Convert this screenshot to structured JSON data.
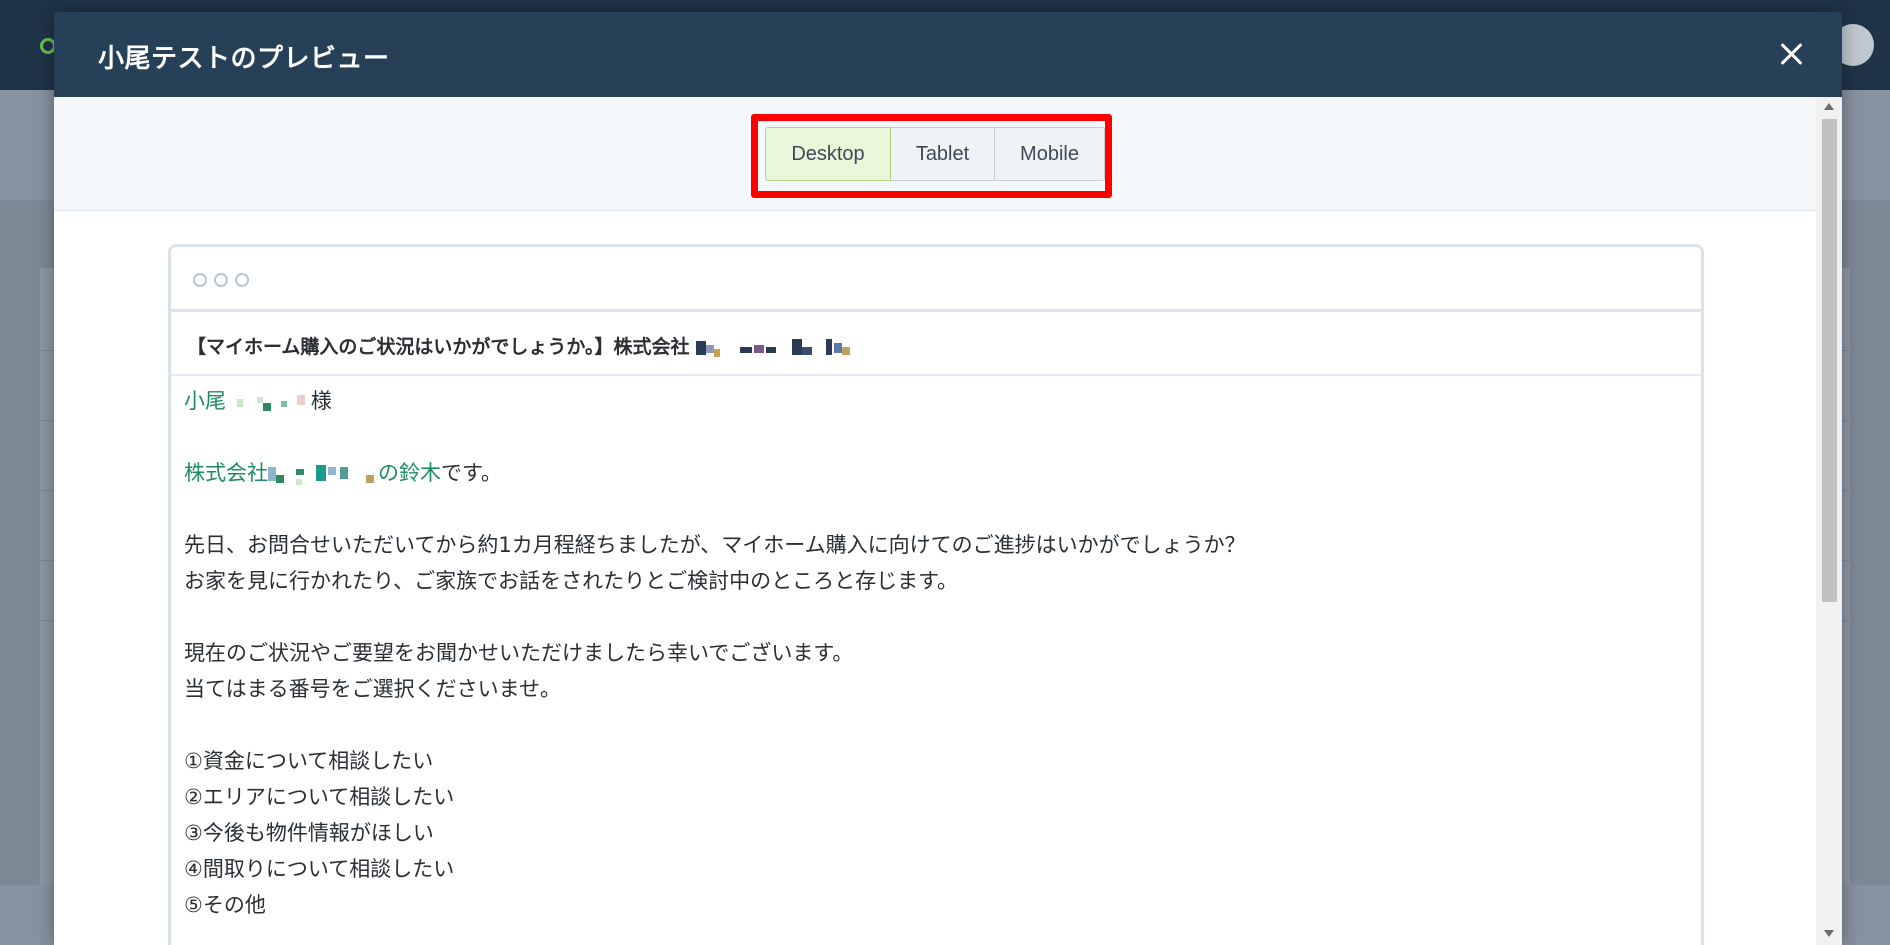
{
  "modal": {
    "title": "小尾テストのプレビュー"
  },
  "device_tabs": [
    {
      "label": "Desktop",
      "selected": true
    },
    {
      "label": "Tablet",
      "selected": false
    },
    {
      "label": "Mobile",
      "selected": false
    }
  ],
  "email": {
    "subject": "【マイホーム購入のご状況はいかがでしょうか。】株式会社",
    "greeting_name": "小尾",
    "greeting_suffix": "様",
    "company_prefix": "株式会社",
    "sender_joiner": "の",
    "sender_name": "鈴木",
    "sender_suffix": "です。",
    "paragraph1": [
      "先日、お問合せいただいてから約1カ月程経ちましたが、マイホーム購入に向けてのご進捗はいかがでしょうか？",
      "お家を見に行かれたり、ご家族でお話をされたりとご検討中のところと存じます。"
    ],
    "paragraph2": [
      "現在のご状況やご要望をお聞かせいただけましたら幸いでございます。",
      "当てはまる番号をご選択くださいませ。"
    ],
    "options": [
      "①資金について相談したい",
      "②エリアについて相談したい",
      "③今後も物件情報がほしい",
      "④間取りについて相談したい",
      "⑤その他"
    ]
  },
  "colors": {
    "header": "#264157",
    "selected_tab": "#eaf6d9",
    "highlight": "#ff0000",
    "link_green": "#1e8c63"
  }
}
